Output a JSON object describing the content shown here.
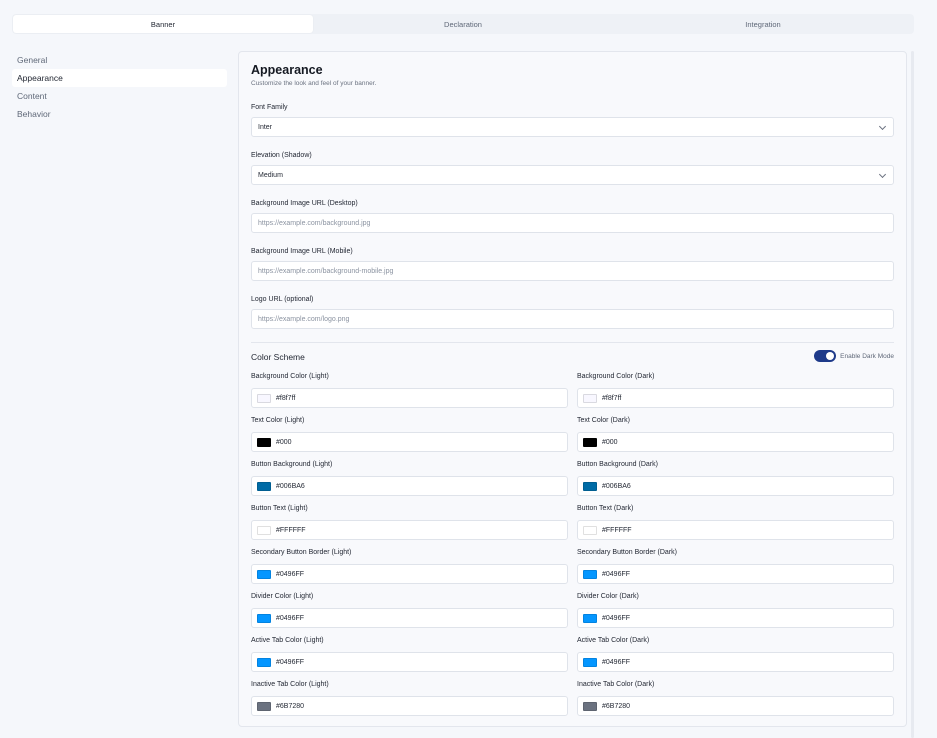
{
  "tabs": [
    "Banner",
    "Declaration",
    "Integration"
  ],
  "sidenav": {
    "items": [
      "General",
      "Appearance",
      "Content",
      "Behavior"
    ]
  },
  "card": {
    "title": "Appearance",
    "subtitle": "Customize the look and feel of your banner.",
    "font_family": {
      "label": "Font Family",
      "value": "Inter"
    },
    "elevation": {
      "label": "Elevation (Shadow)",
      "value": "Medium"
    },
    "bg_desktop": {
      "label": "Background Image URL (Desktop)",
      "placeholder": "https://example.com/background.jpg"
    },
    "bg_mobile": {
      "label": "Background Image URL (Mobile)",
      "placeholder": "https://example.com/background-mobile.jpg"
    },
    "logo": {
      "label": "Logo URL (optional)",
      "placeholder": "https://example.com/logo.png"
    },
    "color_scheme": "Color Scheme",
    "dark_mode_label": "Enable Dark Mode",
    "colors": [
      {
        "light": {
          "label": "Background Color (Light)",
          "value": "#f8f7ff",
          "swatch": "#f8f7ff"
        },
        "dark": {
          "label": "Background Color (Dark)",
          "value": "#f8f7ff",
          "swatch": "#f8f7ff"
        }
      },
      {
        "light": {
          "label": "Text Color (Light)",
          "value": "#000",
          "swatch": "#000000"
        },
        "dark": {
          "label": "Text Color (Dark)",
          "value": "#000",
          "swatch": "#000000"
        }
      },
      {
        "light": {
          "label": "Button Background (Light)",
          "value": "#006BA6",
          "swatch": "#006BA6"
        },
        "dark": {
          "label": "Button Background (Dark)",
          "value": "#006BA6",
          "swatch": "#006BA6"
        }
      },
      {
        "light": {
          "label": "Button Text (Light)",
          "value": "#FFFFFF",
          "swatch": "#FFFFFF"
        },
        "dark": {
          "label": "Button Text (Dark)",
          "value": "#FFFFFF",
          "swatch": "#FFFFFF"
        }
      },
      {
        "light": {
          "label": "Secondary Button Border (Light)",
          "value": "#0496FF",
          "swatch": "#0496FF"
        },
        "dark": {
          "label": "Secondary Button Border (Dark)",
          "value": "#0496FF",
          "swatch": "#0496FF"
        }
      },
      {
        "light": {
          "label": "Divider Color (Light)",
          "value": "#0496FF",
          "swatch": "#0496FF"
        },
        "dark": {
          "label": "Divider Color (Dark)",
          "value": "#0496FF",
          "swatch": "#0496FF"
        }
      },
      {
        "light": {
          "label": "Active Tab Color (Light)",
          "value": "#0496FF",
          "swatch": "#0496FF"
        },
        "dark": {
          "label": "Active Tab Color (Dark)",
          "value": "#0496FF",
          "swatch": "#0496FF"
        }
      },
      {
        "light": {
          "label": "Inactive Tab Color (Light)",
          "value": "#6B7280",
          "swatch": "#6B7280"
        },
        "dark": {
          "label": "Inactive Tab Color (Dark)",
          "value": "#6B7280",
          "swatch": "#6B7280"
        }
      }
    ]
  }
}
